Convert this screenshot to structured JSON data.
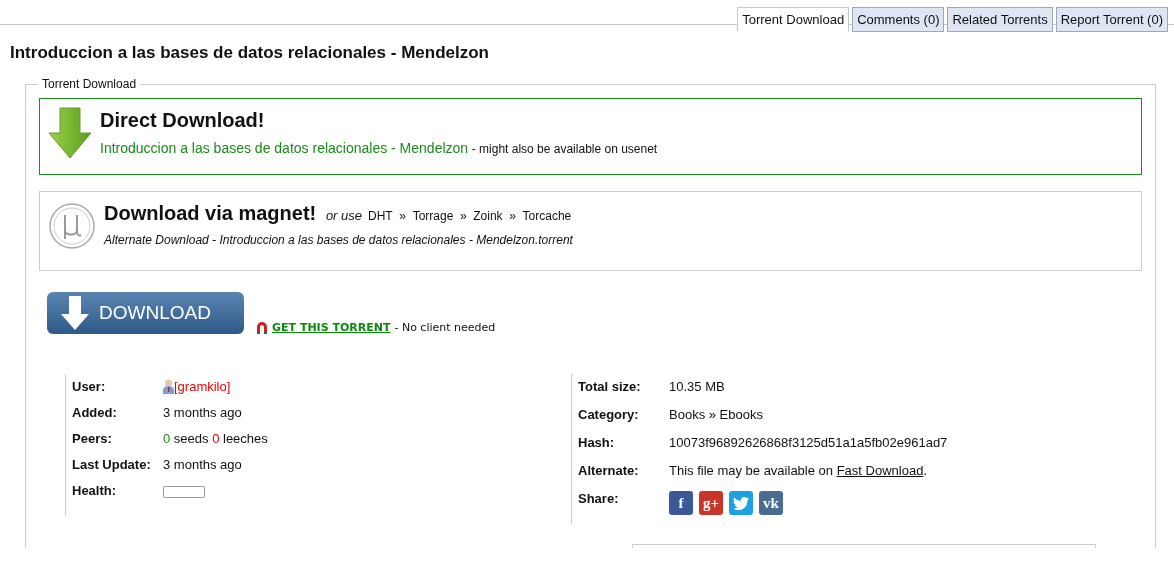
{
  "tabs": [
    {
      "label": "Torrent Download",
      "selected": true
    },
    {
      "label": "Comments (0)",
      "selected": false
    },
    {
      "label": "Related Torrents",
      "selected": false
    },
    {
      "label": "Report Torrent (0)",
      "selected": false
    }
  ],
  "title": "Introduccion a las bases de datos relacionales - Mendelzon",
  "section": {
    "legend": "Torrent Download",
    "direct": {
      "heading": "Direct Download!",
      "link": "Introduccion a las bases de datos relacionales - Mendelzon",
      "note": "- might also be available on usenet"
    },
    "magnet": {
      "heading": "Download via magnet!",
      "or_use": "or use",
      "sources": [
        "DHT",
        "»",
        "Torrage",
        "»",
        "Zoink",
        "»",
        "Torcache"
      ],
      "alternate": "Alternate Download - Introduccion a las bases de datos relacionales - Mendelzon.torrent"
    },
    "download_button": "DOWNLOAD",
    "get_torrent": {
      "link": "GET THIS TORRENT",
      "note": "- No client needed"
    },
    "details_left": [
      {
        "kind": "user",
        "label": "User:",
        "value": "[gramkilo]"
      },
      {
        "kind": "text",
        "label": "Added:",
        "value": "3 months ago"
      },
      {
        "kind": "peers",
        "label": "Peers:",
        "seeds": "0",
        "seeds_word": "seeds",
        "leeches": "0",
        "leeches_word": "leeches"
      },
      {
        "kind": "text",
        "label": "Last Update:",
        "value": "3 months ago"
      },
      {
        "kind": "health",
        "label": "Health:",
        "level": 0
      }
    ],
    "details_right": [
      {
        "kind": "text",
        "label": "Total size:",
        "value": "10.35 MB"
      },
      {
        "kind": "text",
        "label": "Category:",
        "value": "Books » Ebooks"
      },
      {
        "kind": "text",
        "label": "Hash:",
        "value": "10073f96892626868f3125d51a1a5fb02e961ad7"
      },
      {
        "kind": "alternate",
        "label": "Alternate:",
        "before": "This file may be available on",
        "link": "Fast Download",
        "after": "."
      },
      {
        "kind": "share",
        "label": "Share:",
        "buttons": [
          {
            "kind": "letter",
            "glyph": "f",
            "color": "#3b5998"
          },
          {
            "kind": "letter",
            "glyph": "g+",
            "color": "#c8362a"
          },
          {
            "kind": "bird",
            "color": "#1da1e2"
          },
          {
            "kind": "letter",
            "glyph": "vk",
            "color": "#4b6b8f"
          }
        ]
      }
    ]
  }
}
